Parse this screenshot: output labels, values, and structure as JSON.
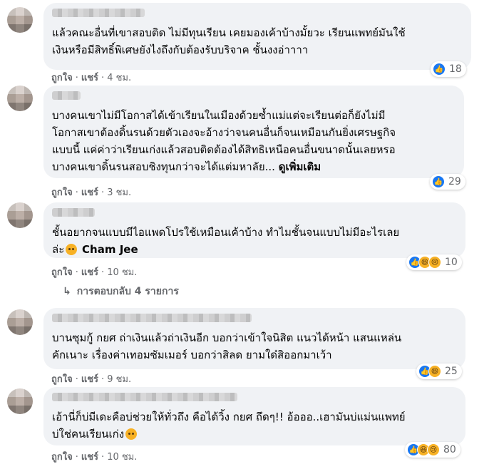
{
  "colors": {
    "bubble": "#f0f2f5",
    "meta": "#65676b",
    "text": "#050505",
    "like": "#1877f2",
    "haha": "#f7b125"
  },
  "actions": {
    "like": "ถูกใจ",
    "reply": "แชร์",
    "separator": "·"
  },
  "comments": [
    {
      "text": "แล้วคณะอื่นที่เขาสอบติด ไม่มีทุนเรียน เคยมองเค้าบ้างมั้ยวะ เรียนแพทย์มันใช้\nเงินหรือมีสิทธิ์พิเศษยังไงถึงกับต้องรับบริจาค ชั้นงงอ่าาาา",
      "time": "4 ชม.",
      "reactions": [
        "like-icon"
      ],
      "count": "18"
    },
    {
      "text": "บางคนเขาไม่มีโอกาสได้เข้าเรียนในเมืองด้วยซ้ำแม่แต่จะเรียนต่อก็ยังไม่มี\nโอกาสเขาต้องดิ้นรนด้วยตัวเองจะอ้างว่าจนคนอื่นก็จนเหมือนกันยิ่งเศรษฐกิจ\nแบบนี้ แค่ค่าว่าเรียนเก่งแล้วสอบติดต้องได้สิทธิเหนือคนอื่นขนาดนั้นเลยหรอ\nบางคนเขาดิ้นรนสอบชิงทุนกว่าจะได้แต่มหาลัย...",
      "see_more": "ดูเพิ่มเติม",
      "time": "3 ชม.",
      "reactions": [
        "like-icon"
      ],
      "count": "29"
    },
    {
      "text": "ชั้นอยากจนแบบมีไอแพดโปรใช้เหมือนเค้าบ้าง ทำไมชั้นจนแบบไม่มีอะไรเลย\nล่ะ",
      "mention": "Cham Jee",
      "time": "10 ชม.",
      "reactions": [
        "like-icon",
        "haha-icon",
        "sad-icon"
      ],
      "count": "10"
    },
    {
      "text": "บานซุมกู้ กยศ ถ่าเงินแล้วถ่าเงินอีก บอกว่าเข้าใจนิสิต แนวได้หน้า แสนแหล่น\nคักเนาะ เรื่องค่าเทอมซัมเมอร์ บอกว่าสิลด ยามใด๋สิออกมาเว้า",
      "time": "9 ชม.",
      "reactions": [
        "like-icon",
        "haha-icon"
      ],
      "count": "25"
    },
    {
      "text": "เอ้านี่ก็บ่มีเดะคือบ่ช่วยให้ทั่วถึง คือได้วิ้ง กยศ ถึดๆ!! อ้อออ..เฮามันบ่แม่นแพทย์\nบ่ใช่คนเรียนเก่ง",
      "time": "10 ชม.",
      "reactions": [
        "like-icon",
        "haha-icon",
        "sad-icon"
      ],
      "count": "80"
    }
  ],
  "replies_label": "การตอบกลับ 4 รายการ"
}
